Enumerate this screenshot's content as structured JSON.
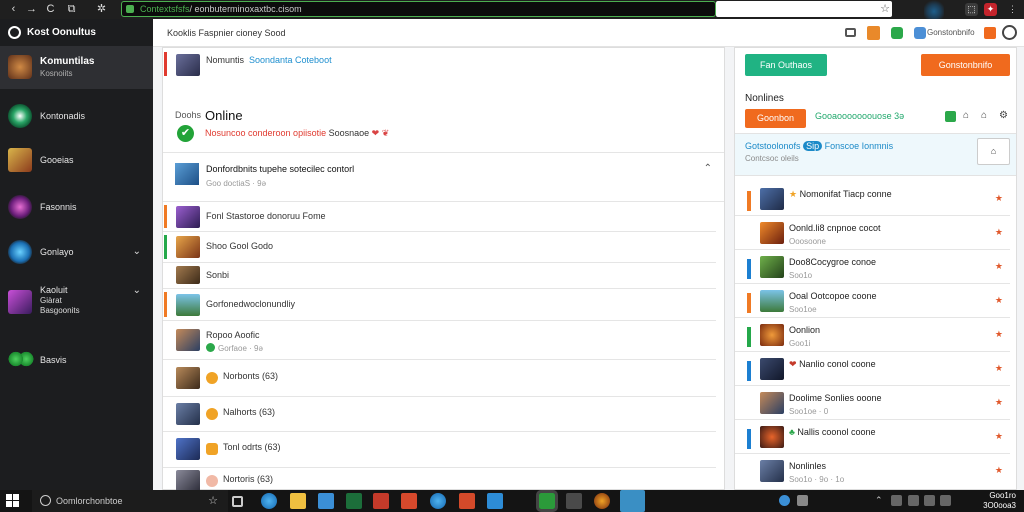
{
  "browser": {
    "url_secure": "Contextsfsfs",
    "url_rest": "/ eonbuterminoxaxtbc.cisom",
    "back_label": "‹",
    "forward_label": "→",
    "reload_label": "C",
    "tabs_label": "⧉",
    "nav_extra": "✲",
    "star_label": "☆",
    "ext_icons": [
      "red-extension-icon",
      "white-extension-icon",
      "menu-icon"
    ]
  },
  "sidebar": {
    "header": "Kost Oonultus",
    "items": [
      {
        "label": "Komuntilas",
        "sub": "Kosnoiits",
        "icon": "avatar-warrior-icon",
        "chevron": false
      },
      {
        "label": "Kontonadis",
        "sub": "",
        "icon": "green-globe-icon",
        "chevron": false
      },
      {
        "label": "Gooeias",
        "sub": "",
        "icon": "game-art-icon",
        "chevron": false
      },
      {
        "label": "Fasonnis",
        "sub": "",
        "icon": "purple-orb-icon",
        "chevron": false
      },
      {
        "label": "Gonlayo",
        "sub": "",
        "icon": "blue-globe-icon",
        "chevron": true
      },
      {
        "label": "Kaoluit",
        "sub": "Giàrat\nBasgoonits",
        "icon": "purple-game-icon",
        "chevron": true
      },
      {
        "label": "Basvis",
        "sub": "",
        "icon": "green-clover-icon",
        "chevron": false
      }
    ]
  },
  "main": {
    "header": "Kooklis Faspnier cioney Sood",
    "first_row": {
      "title": "Nomuntis",
      "link": "Soondanta Coteboot"
    },
    "status": {
      "small": "Doohs",
      "big": "Online",
      "note": "Nosuncoo conderoon opiisotie",
      "note_tail": "Soosnaoe",
      "hearts": "❤ ❦"
    },
    "post": {
      "title": "Donfordbnits tupehe sotecilec contorl",
      "sub": "Goo doctiaS · 9ə"
    },
    "rows": [
      {
        "title": "Fonl Stastoroe donoruu Fome",
        "sub": "",
        "bar": "#f07a24",
        "thumb": "thumb-purple"
      },
      {
        "title": "Shoo Gool Godo",
        "sub": "",
        "bar": "#24a84a",
        "thumb": "thumb-orange"
      },
      {
        "title": "Sonbi",
        "sub": "",
        "bar": "",
        "thumb": "thumb-brown"
      },
      {
        "title": "Gorfonedwoclonundliy",
        "sub": "",
        "bar": "#f07a24",
        "thumb": "thumb-landscape"
      },
      {
        "title": "Ropoo Aoofic",
        "sub": "Gorfaoe · 9ə",
        "bar": "",
        "thumb": "thumb-face"
      },
      {
        "title": "Norbonts (63)",
        "sub": "",
        "bar": "",
        "thumb": "thumb-warrior"
      },
      {
        "title": "Nalhorts (63)",
        "sub": "",
        "bar": "",
        "thumb": "thumb-knight"
      },
      {
        "title": "Tonl odrts (63)",
        "sub": "",
        "bar": "",
        "thumb": "thumb-castle"
      },
      {
        "title": "Nortoris (63)",
        "sub": "",
        "bar": "",
        "thumb": "thumb-portrait"
      }
    ]
  },
  "right": {
    "green_button": "Fan Outhaos",
    "orange_button": "Gonstonbnifo",
    "nonlines_title": "Nonlines",
    "nonlines_btn": "Goonbon",
    "nonlines_text": "Gooaooooooouose 3ə",
    "info_title": "Gotstoolonofs",
    "info_pill": "Sip",
    "info_title2": "Fonscoe Ionmnis",
    "info_sub": "Contcsoc oleils",
    "info_box": "⌂",
    "rows": [
      {
        "title": "Nomonifat Tiacp conne",
        "sub": "",
        "bar": "#f07a24",
        "thumb": "thumb-hero",
        "badge": "★"
      },
      {
        "title": "Oonld.li8 cnpnoe cocot",
        "sub": "Ooosoone",
        "bar": "",
        "thumb": "thumb-fire",
        "badge": ""
      },
      {
        "title": "Doo8Cocygroe conoe",
        "sub": "Soo1o",
        "bar": "#1c7fd1",
        "thumb": "thumb-tree",
        "badge": ""
      },
      {
        "title": "Ooal Ootcopoe coone",
        "sub": "Soo1oe",
        "bar": "#f07a24",
        "thumb": "thumb-landscape",
        "badge": ""
      },
      {
        "title": "Oonlion",
        "sub": "Goo1i",
        "bar": "#24a84a",
        "thumb": "thumb-orange",
        "badge": ""
      },
      {
        "title": "Nanlio conol coone",
        "sub": "",
        "bar": "#1c7fd1",
        "thumb": "thumb-dark",
        "badge": "❤"
      },
      {
        "title": "Doolime Sonlies ooone",
        "sub": "Soo1oe · 0",
        "bar": "",
        "thumb": "thumb-face",
        "badge": ""
      },
      {
        "title": "Nallis coonol coone",
        "sub": "",
        "bar": "#1c7fd1",
        "thumb": "thumb-ember",
        "badge": "♣"
      },
      {
        "title": "Nonlinles",
        "sub": "Soo1o · 9o · 1o",
        "bar": "",
        "thumb": "thumb-knight",
        "badge": ""
      }
    ]
  },
  "taskbar": {
    "search_placeholder": "Oomlorchonbtoe",
    "clock_time": "Goo1ro",
    "clock_date": "3O0ooa3"
  }
}
